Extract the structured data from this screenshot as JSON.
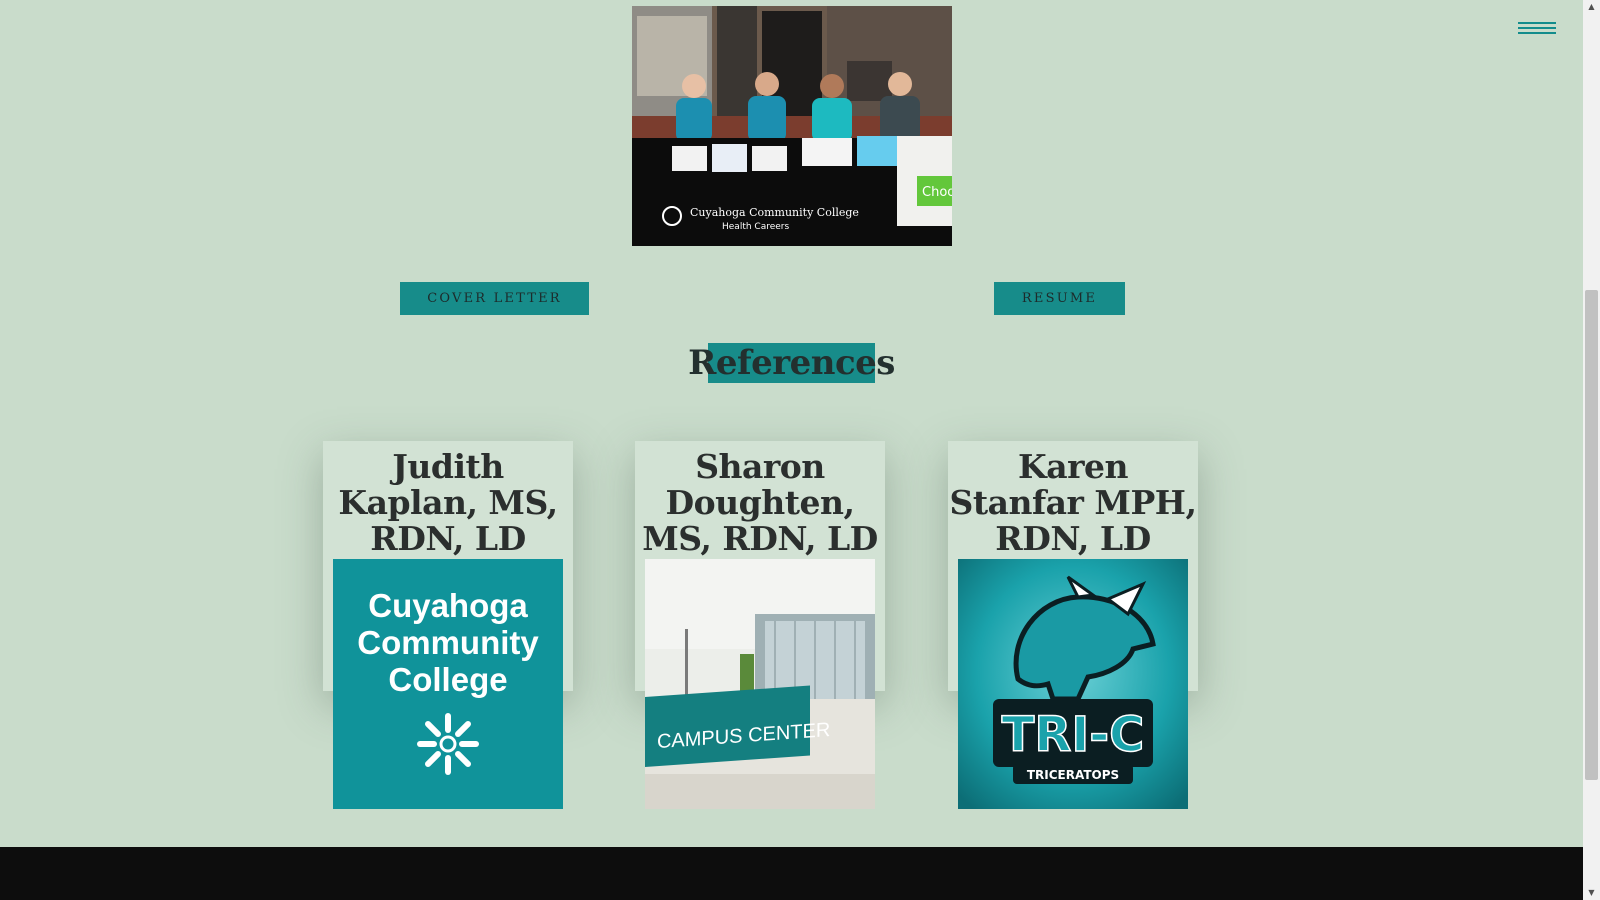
{
  "header": {
    "menu_icon": "hamburger-menu-icon",
    "accent": "#138c8c"
  },
  "hero": {
    "table_banner_line1": "Cuyahoga Community College",
    "table_banner_line2": "Health Careers",
    "table_sign_text": "Choo"
  },
  "buttons": {
    "cover_letter": "COVER LETTER",
    "resume": "RESUME"
  },
  "references": {
    "title": "References",
    "cards": [
      {
        "name": "Judith Kaplan, MS, RDN, LD",
        "logo_lines": [
          "Cuyahoga",
          "Community",
          "College"
        ]
      },
      {
        "name": "Sharon Doughten, MS, RDN, LD",
        "sign_text": "CAMPUS CENTER"
      },
      {
        "name": "Karen Stanfar MPH, RDN, LD",
        "logo_text": "TRI-C",
        "logo_sub": "TRICERATOPS"
      }
    ]
  },
  "colors": {
    "background": "#c9dccb",
    "teal": "#178c8a",
    "footer": "#0d0d0d"
  }
}
